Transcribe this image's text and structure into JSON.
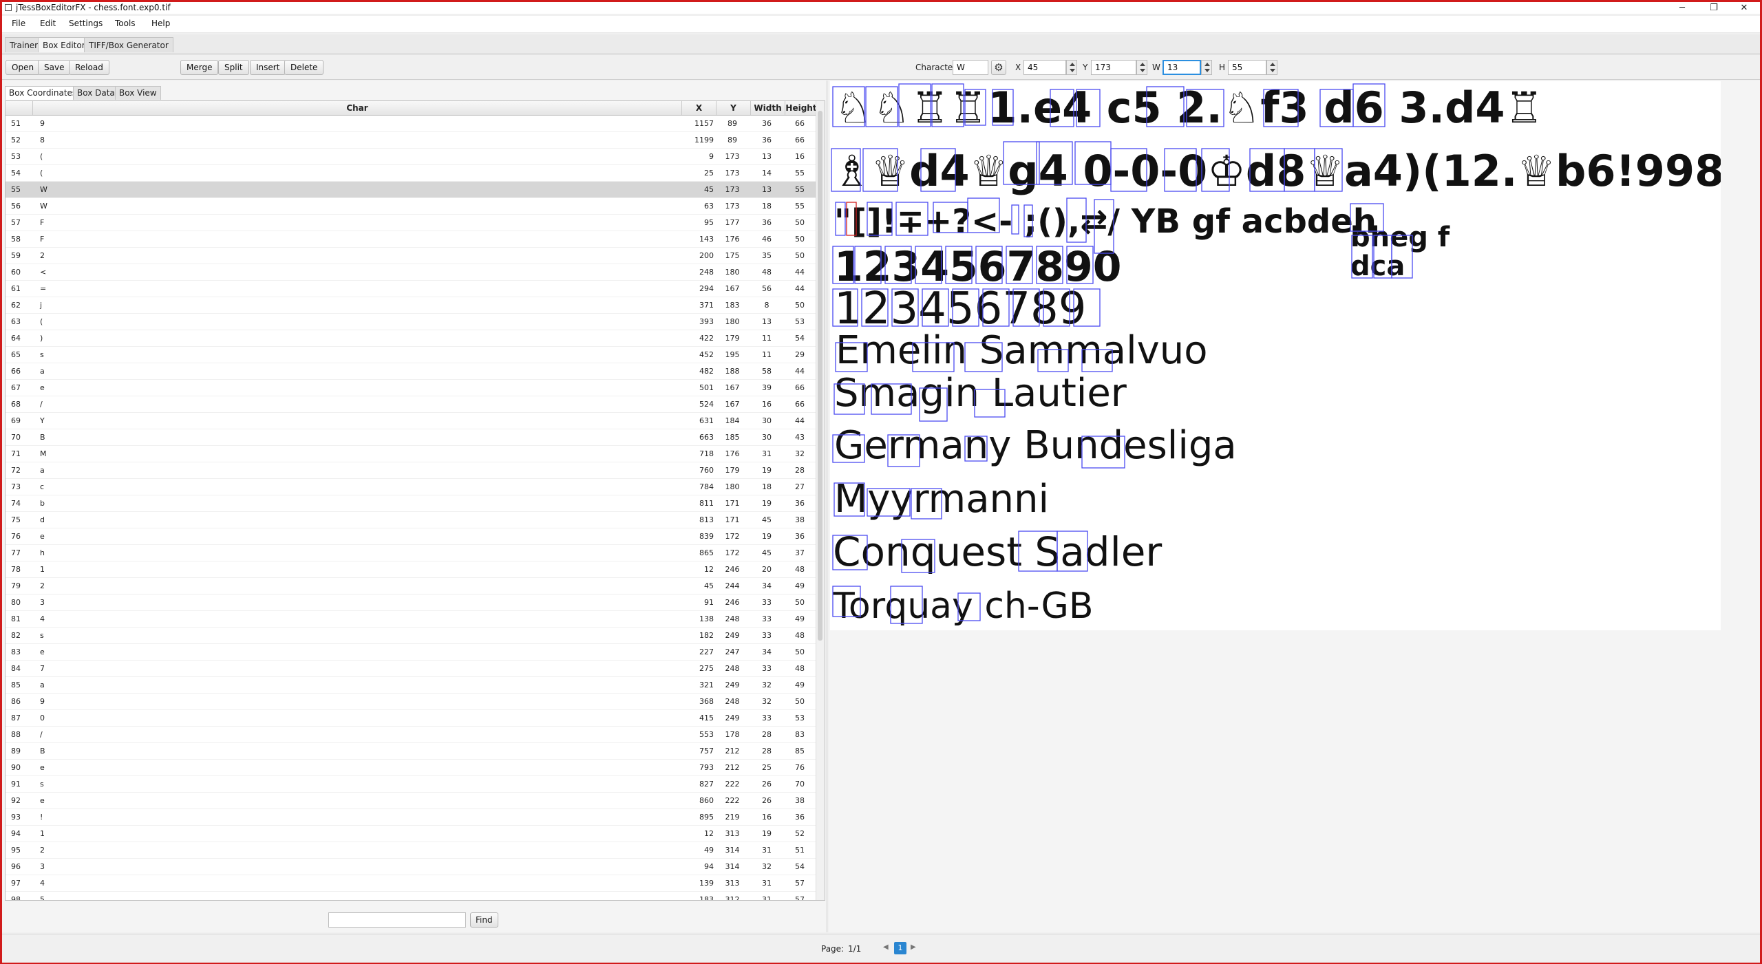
{
  "window": {
    "title": "jTessBoxEditorFX - chess.font.exp0.tif",
    "min": "─",
    "max": "❐",
    "close": "✕"
  },
  "menu": [
    "File",
    "Edit",
    "Settings",
    "Tools",
    "Help"
  ],
  "main_tabs": [
    {
      "label": "Trainer",
      "active": false
    },
    {
      "label": "Box Editor",
      "active": true
    },
    {
      "label": "TIFF/Box Generator",
      "active": false
    }
  ],
  "toolbar": {
    "buttons": [
      "Open",
      "Save",
      "Reload",
      "Merge",
      "Split",
      "Insert",
      "Delete"
    ],
    "character_label": "Character",
    "character_value": "W",
    "x_label": "X",
    "x_value": "45",
    "y_label": "Y",
    "y_value": "173",
    "w_label": "W",
    "w_value": "13",
    "h_label": "H",
    "h_value": "55"
  },
  "sub_tabs": [
    {
      "label": "Box Coordinates",
      "active": true
    },
    {
      "label": "Box Data",
      "active": false
    },
    {
      "label": "Box View",
      "active": false
    }
  ],
  "table": {
    "columns": [
      "Char",
      "X",
      "Y",
      "Width",
      "Height"
    ],
    "selected_index": 55,
    "rows": [
      [
        "51",
        "9",
        "1157",
        "89",
        "36",
        "66"
      ],
      [
        "52",
        "8",
        "1199",
        "89",
        "36",
        "66"
      ],
      [
        "53",
        "(",
        "9",
        "173",
        "13",
        "16"
      ],
      [
        "54",
        "(",
        "25",
        "173",
        "14",
        "55"
      ],
      [
        "55",
        "W",
        "45",
        "173",
        "13",
        "55"
      ],
      [
        "56",
        "W",
        "63",
        "173",
        "18",
        "55"
      ],
      [
        "57",
        "F",
        "95",
        "177",
        "36",
        "50"
      ],
      [
        "58",
        "F",
        "143",
        "176",
        "46",
        "50"
      ],
      [
        "59",
        "2",
        "200",
        "175",
        "35",
        "50"
      ],
      [
        "60",
        "<",
        "248",
        "180",
        "48",
        "44"
      ],
      [
        "61",
        "=",
        "294",
        "167",
        "56",
        "44"
      ],
      [
        "62",
        "j",
        "371",
        "183",
        "8",
        "50"
      ],
      [
        "63",
        "(",
        "393",
        "180",
        "13",
        "53"
      ],
      [
        "64",
        ")",
        "422",
        "179",
        "11",
        "54"
      ],
      [
        "65",
        "s",
        "452",
        "195",
        "11",
        "29"
      ],
      [
        "66",
        "a",
        "482",
        "188",
        "58",
        "44"
      ],
      [
        "67",
        "e",
        "501",
        "167",
        "39",
        "66"
      ],
      [
        "68",
        "/",
        "524",
        "167",
        "16",
        "66"
      ],
      [
        "69",
        "Y",
        "631",
        "184",
        "30",
        "44"
      ],
      [
        "70",
        "B",
        "663",
        "185",
        "30",
        "43"
      ],
      [
        "71",
        "M",
        "718",
        "176",
        "31",
        "32"
      ],
      [
        "72",
        "a",
        "760",
        "179",
        "19",
        "28"
      ],
      [
        "73",
        "c",
        "784",
        "180",
        "18",
        "27"
      ],
      [
        "74",
        "b",
        "811",
        "171",
        "19",
        "36"
      ],
      [
        "75",
        "d",
        "813",
        "171",
        "45",
        "38"
      ],
      [
        "76",
        "e",
        "839",
        "172",
        "19",
        "36"
      ],
      [
        "77",
        "h",
        "865",
        "172",
        "45",
        "37"
      ],
      [
        "78",
        "1",
        "12",
        "246",
        "20",
        "48"
      ],
      [
        "79",
        "2",
        "45",
        "244",
        "34",
        "49"
      ],
      [
        "80",
        "3",
        "91",
        "246",
        "33",
        "50"
      ],
      [
        "81",
        "4",
        "138",
        "248",
        "33",
        "49"
      ],
      [
        "82",
        "s",
        "182",
        "249",
        "33",
        "48"
      ],
      [
        "83",
        "e",
        "227",
        "247",
        "34",
        "50"
      ],
      [
        "84",
        "7",
        "275",
        "248",
        "33",
        "48"
      ],
      [
        "85",
        "a",
        "321",
        "249",
        "32",
        "49"
      ],
      [
        "86",
        "9",
        "368",
        "248",
        "32",
        "50"
      ],
      [
        "87",
        "0",
        "415",
        "249",
        "33",
        "53"
      ],
      [
        "88",
        "/",
        "553",
        "178",
        "28",
        "83"
      ],
      [
        "89",
        "B",
        "757",
        "212",
        "28",
        "85"
      ],
      [
        "90",
        "e",
        "793",
        "212",
        "25",
        "76"
      ],
      [
        "91",
        "s",
        "827",
        "222",
        "26",
        "70"
      ],
      [
        "92",
        "e",
        "860",
        "222",
        "26",
        "38"
      ],
      [
        "93",
        "!",
        "895",
        "219",
        "16",
        "36"
      ],
      [
        "94",
        "1",
        "12",
        "313",
        "19",
        "52"
      ],
      [
        "95",
        "2",
        "49",
        "314",
        "31",
        "51"
      ],
      [
        "96",
        "3",
        "94",
        "314",
        "32",
        "54"
      ],
      [
        "97",
        "4",
        "139",
        "313",
        "31",
        "57"
      ],
      [
        "98",
        "5",
        "183",
        "312",
        "31",
        "57"
      ]
    ]
  },
  "find": {
    "value": "",
    "button": "Find"
  },
  "pager": {
    "label": "Page:",
    "of": "1/1",
    "current": "1",
    "prev": "◀",
    "next": "▶"
  },
  "glyph_image": {
    "lines": [
      "♘♘♖♖1.e4 c5 2.♘f3 d6 3.d4♖",
      "♗♕d4♕g4 0-0-0♔d8♕a4)(12.♕b6!998",
      "\"[]!∓+?<- ;(),⇄/ YB gf acbdeh",
      "bheg f",
      "dca",
      "1234567890",
      "123456789",
      "Emelin Sammalvuo",
      "Smagin Lautier",
      "Germany Bundesliga",
      "Myyrmanni",
      "Conquest Sadler",
      "Torquay ch-GB"
    ]
  }
}
